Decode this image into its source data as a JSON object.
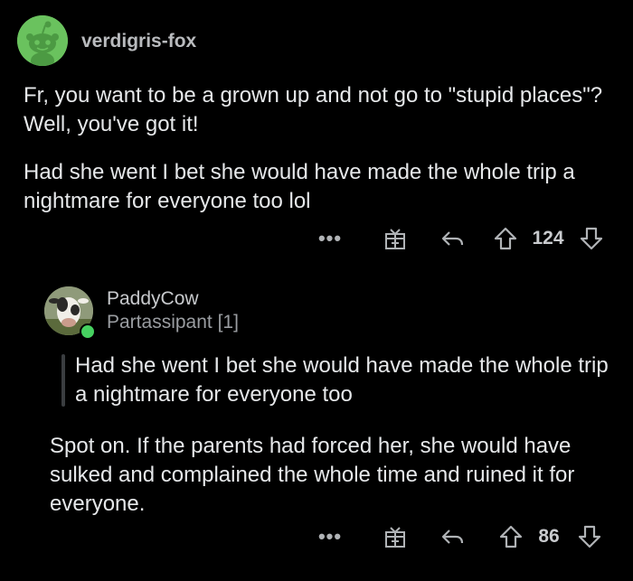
{
  "comment": {
    "username": "verdigris-fox",
    "paragraphs": [
      "Fr, you want to be a grown up and not go to \"stupid places\"? Well, you've got it!",
      "Had she went I bet she would have made the whole trip a nightmare for everyone too lol"
    ],
    "more_label": "•••",
    "score": "124"
  },
  "reply": {
    "username": "PaddyCow",
    "flair": "Partassipant [1]",
    "quote": "Had she went I bet she would have made the whole trip a nightmare for everyone too",
    "body": "Spot on. If the parents had forced her, she would have sulked and complained the whole time and ruined it for everyone.",
    "more_label": "•••",
    "score": "86"
  },
  "colors": {
    "background": "#000000",
    "avatar_green": "#6ac25e",
    "online_green": "#46d160",
    "text": "#e6e8ea",
    "muted": "#9a9da1"
  },
  "icons": [
    "snoo-avatar-icon",
    "more-icon",
    "award-icon",
    "reply-icon",
    "upvote-icon",
    "downvote-icon",
    "online-status-icon"
  ]
}
